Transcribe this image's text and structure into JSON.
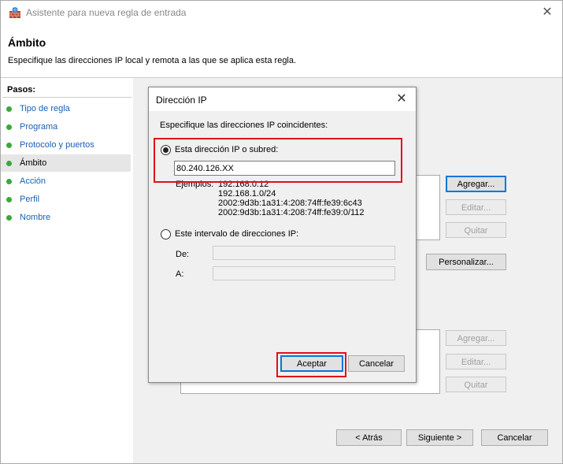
{
  "window": {
    "title": "Asistente para nueva regla de entrada"
  },
  "header": {
    "title": "Ámbito",
    "description": "Especifique las direcciones IP local y remota a las que se aplica esta regla."
  },
  "sidebar": {
    "heading": "Pasos:",
    "items": [
      {
        "label": "Tipo de regla"
      },
      {
        "label": "Programa"
      },
      {
        "label": "Protocolo y puertos"
      },
      {
        "label": "Ámbito"
      },
      {
        "label": "Acción"
      },
      {
        "label": "Perfil"
      },
      {
        "label": "Nombre"
      }
    ]
  },
  "background_buttons": {
    "agregar1": "Agregar...",
    "editar1": "Editar...",
    "quitar1": "Quitar",
    "personalizar": "Personalizar...",
    "agregar2": "Agregar...",
    "editar2": "Editar...",
    "quitar2": "Quitar"
  },
  "nav": {
    "back": "< Atrás",
    "next": "Siguiente >",
    "cancel": "Cancelar"
  },
  "dialog": {
    "title": "Dirección IP",
    "instruction": "Especifique las direcciones IP coincidentes:",
    "option_single": "Esta dirección IP o subred:",
    "ip_value": "80.240.126.XX",
    "examples_label": "Ejemplos:",
    "examples": [
      "192.168.0.12",
      "192.168.1.0/24",
      "2002:9d3b:1a31:4:208:74ff:fe39:6c43",
      "2002:9d3b:1a31:4:208:74ff:fe39:0/112"
    ],
    "option_range": "Este intervalo de direcciones IP:",
    "from_label": "De:",
    "to_label": "A:",
    "ok": "Aceptar",
    "cancel": "Cancelar"
  },
  "colors": {
    "highlight": "#e0101a",
    "link": "#1a5fb4",
    "step_dot": "#3aa83a"
  }
}
